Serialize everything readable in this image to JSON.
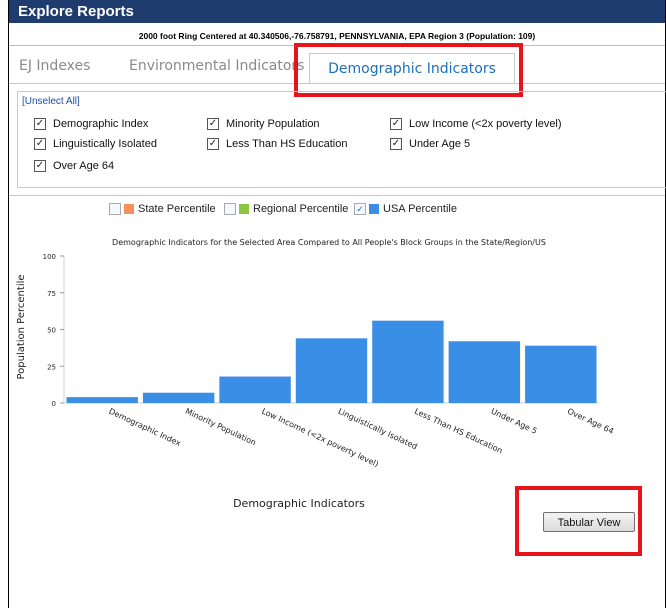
{
  "window": {
    "title": "Explore Reports",
    "subtitle": "2000 foot Ring Centered at 40.340506,-76.758791, PENNSYLVANIA, EPA Region 3 (Population: 109)"
  },
  "tabs": [
    {
      "label": "EJ Indexes",
      "active": false
    },
    {
      "label": "Environmental Indicators",
      "active": false
    },
    {
      "label": "Demographic Indicators",
      "active": true
    }
  ],
  "filters": {
    "unselect_all": "[Unselect All]",
    "checkboxes": [
      {
        "label": "Demographic Index",
        "checked": true
      },
      {
        "label": "Minority Population",
        "checked": true
      },
      {
        "label": "Low Income (<2x poverty level)",
        "checked": true
      },
      {
        "label": "Linguistically Isolated",
        "checked": true
      },
      {
        "label": "Less Than HS Education",
        "checked": true
      },
      {
        "label": "Under Age 5",
        "checked": true
      },
      {
        "label": "Over Age 64",
        "checked": true
      }
    ]
  },
  "legend": [
    {
      "label": "State Percentile",
      "color": "#f4915c",
      "checked": false
    },
    {
      "label": "Regional Percentile",
      "color": "#8cc63e",
      "checked": false
    },
    {
      "label": "USA Percentile",
      "color": "#3a8ee6",
      "checked": true
    }
  ],
  "chart_data": {
    "type": "bar",
    "title": "Demographic Indicators for the Selected Area Compared to All People's Block Groups in the State/Region/US",
    "xlabel": "Demographic Indicators",
    "ylabel": "Population Percentile",
    "ylim": [
      0,
      100
    ],
    "yticks": [
      0,
      25,
      50,
      75,
      100
    ],
    "categories": [
      "Demographic Index",
      "Minority Population",
      "Low Income (<2x poverty level)",
      "Linguistically Isolated",
      "Less Than HS Education",
      "Under Age 5",
      "Over Age 64"
    ],
    "series": [
      {
        "name": "USA Percentile",
        "color": "#3a8ee6",
        "values": [
          4,
          7,
          18,
          44,
          56,
          42,
          39
        ]
      }
    ],
    "grid": false
  },
  "buttons": {
    "tabular_view": "Tabular View"
  }
}
